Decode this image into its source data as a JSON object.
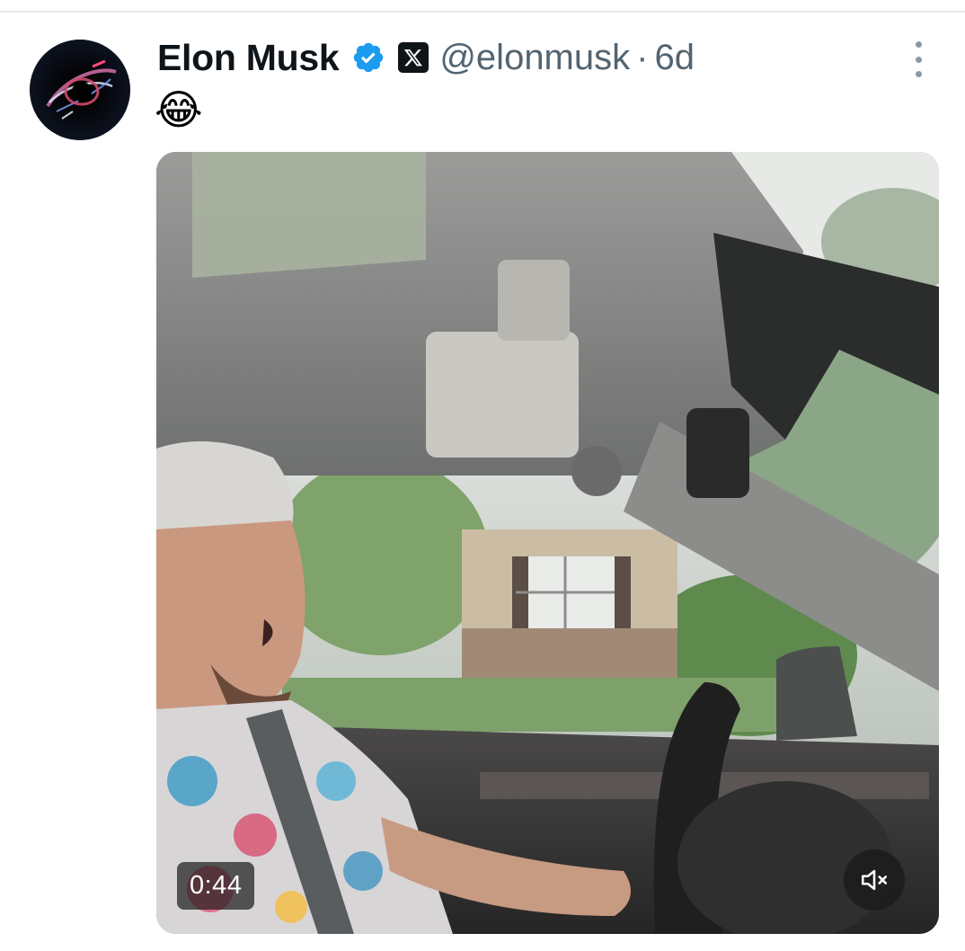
{
  "tweet": {
    "author_name": "Elon Musk",
    "handle": "@elonmusk",
    "separator": "·",
    "time": "6d",
    "text": "😂"
  },
  "media": {
    "duration": "0:44"
  },
  "icons": {
    "avatar": "avatar-image",
    "verified": "verified-badge-icon",
    "affiliate": "x-logo-icon",
    "more": "more-options-icon",
    "mute": "muted-speaker-icon"
  },
  "colors": {
    "name": "#0f1419",
    "secondary": "#536471",
    "verified": "#1d9bf0"
  }
}
